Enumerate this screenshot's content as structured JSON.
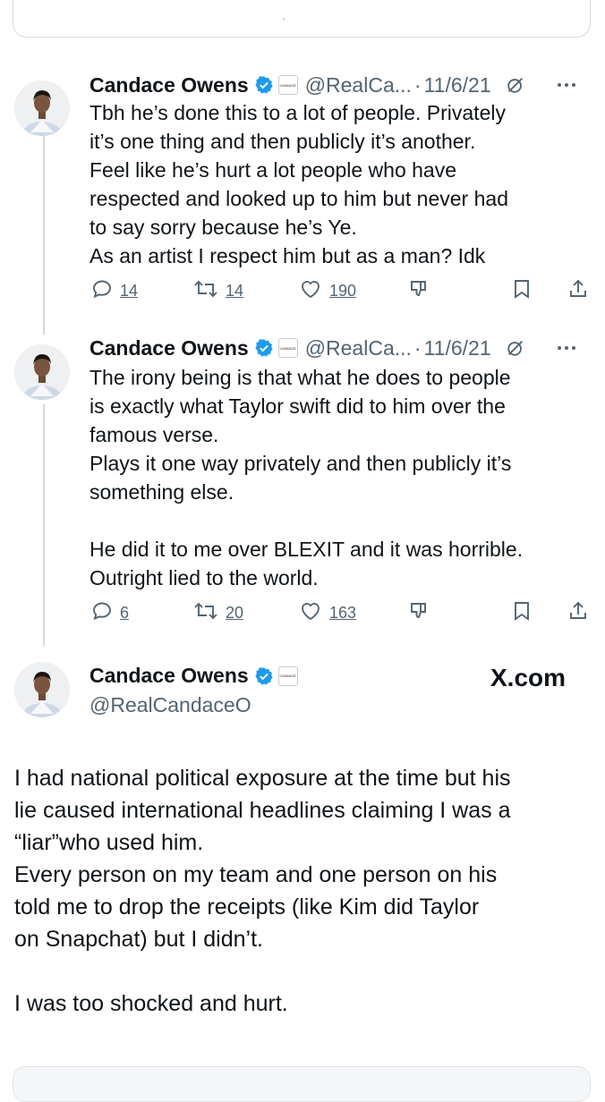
{
  "top_quote": {
    "text": "."
  },
  "author": {
    "name": "Candace Owens",
    "handle": "@RealCa...",
    "full_handle": "@RealCandaceO",
    "affiliate_badge_text": "CANDACE"
  },
  "tweets": [
    {
      "date": "11/6/21",
      "sep": "·",
      "lines": [
        "Tbh he’s done this to a lot of people. Privately",
        "it’s one thing and then publicly it’s another.",
        "Feel like he’s hurt a lot people who have",
        "respected and looked up to him but never had",
        "to say sorry because he’s Ye.",
        "As an artist I respect him but as a man? Idk"
      ],
      "replies": "14",
      "reposts": "14",
      "likes": "190"
    },
    {
      "date": "11/6/21",
      "sep": "·",
      "lines": [
        "The irony being is that what he does to people",
        "is exactly what Taylor swift did to him over the",
        "famous verse.",
        "Plays it one way privately and then publicly it’s",
        "something else.",
        "",
        "He did it to me over BLEXIT and it was horrible.",
        "Outright lied to the world."
      ],
      "replies": "6",
      "reposts": "20",
      "likes": "163"
    }
  ],
  "main_tweet": {
    "site": "X.com",
    "lines": [
      "I had national political exposure at the time but his",
      "lie caused international headlines claiming I was a",
      "“liar”who used him.",
      "Every person on my team and one person on his",
      "told me to drop the receipts (like Kim did Taylor",
      "on Snapchat) but I didn’t.",
      "",
      "I was too shocked and hurt."
    ]
  },
  "colors": {
    "text": "#0f1419",
    "muted": "#536471",
    "verified": "#1d9bf0",
    "thread_line": "#cfd9de"
  },
  "icons": [
    "reply-icon",
    "repost-icon",
    "like-icon",
    "dislike-icon",
    "bookmark-icon",
    "share-icon",
    "grok-icon",
    "more-icon",
    "verified-icon"
  ]
}
